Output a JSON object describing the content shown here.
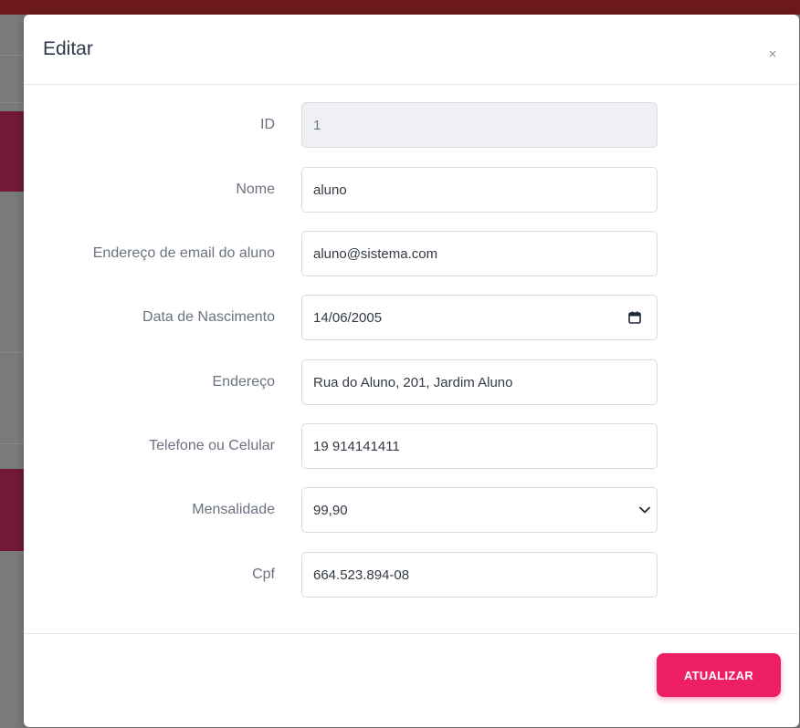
{
  "modal": {
    "title": "Editar",
    "close_label": "×",
    "submit_label": "ATUALIZAR"
  },
  "form": {
    "fields": [
      {
        "label": "ID",
        "value": "1",
        "readonly": true
      },
      {
        "label": "Nome",
        "value": "aluno"
      },
      {
        "label": "Endereço de email do aluno",
        "value": "aluno@sistema.com"
      },
      {
        "label": "Data de Nascimento",
        "value": "14/06/2005",
        "icon": "calendar-icon"
      },
      {
        "label": "Endereço",
        "value": "Rua do Aluno, 201, Jardim Aluno"
      },
      {
        "label": "Telefone ou Celular",
        "value": "19 914141411"
      },
      {
        "label": "Mensalidade",
        "value": "99,90",
        "icon": "chevron-down-icon"
      },
      {
        "label": "Cpf",
        "value": "664.523.894-08"
      }
    ]
  },
  "colors": {
    "accent": "#ee1e63",
    "backdrop": "#7a7a7a",
    "readonly_bg": "#eff0f3"
  }
}
